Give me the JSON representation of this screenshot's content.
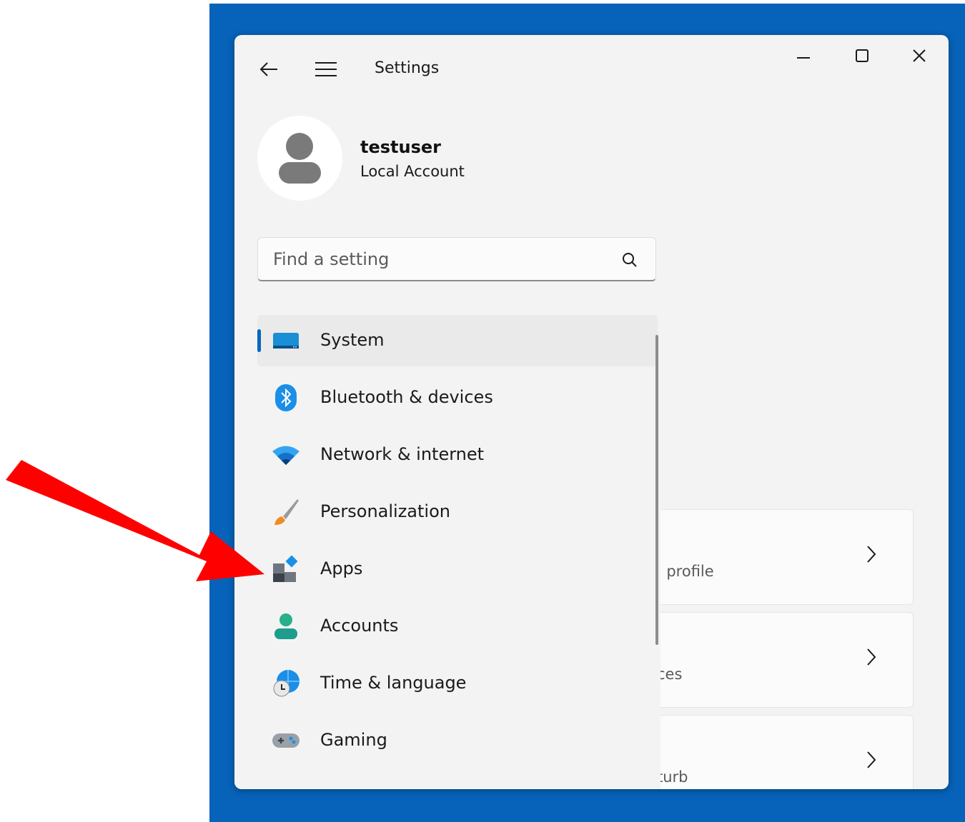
{
  "window": {
    "title": "Settings"
  },
  "user": {
    "name": "testuser",
    "account_type": "Local Account"
  },
  "search": {
    "placeholder": "Find a setting"
  },
  "nav": {
    "items": [
      {
        "label": "System",
        "icon": "system-icon",
        "selected": true
      },
      {
        "label": "Bluetooth & devices",
        "icon": "bluetooth-icon"
      },
      {
        "label": "Network & internet",
        "icon": "wifi-icon"
      },
      {
        "label": "Personalization",
        "icon": "brush-icon"
      },
      {
        "label": "Apps",
        "icon": "apps-icon"
      },
      {
        "label": "Accounts",
        "icon": "accounts-icon"
      },
      {
        "label": "Time & language",
        "icon": "globe-clock-icon"
      },
      {
        "label": "Gaming",
        "icon": "gamepad-icon"
      }
    ]
  },
  "cards": [
    {
      "text": "’ profile"
    },
    {
      "text": "ces"
    },
    {
      "text": "turb"
    }
  ],
  "colors": {
    "desktop": "#0663b9",
    "accent": "#0067c0",
    "annotation_arrow": "#ff0000"
  }
}
